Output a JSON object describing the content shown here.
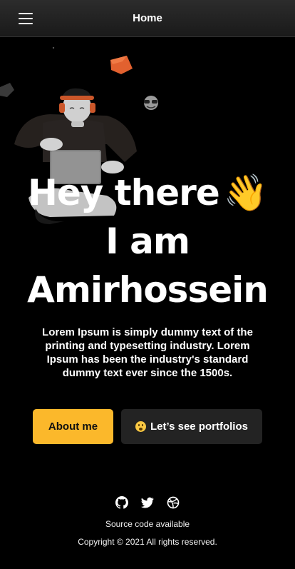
{
  "header": {
    "title": "Home",
    "menu_icon": "hamburger-menu-icon"
  },
  "hero": {
    "headline_line1": "Hey there",
    "headline_line2": "I am",
    "headline_line3": "Amirhossein",
    "wave_emoji": "👋",
    "description": "Lorem Ipsum is simply dummy text of the printing and typesetting industry. Lorem Ipsum has been the industry's standard dummy text ever since the 1500s."
  },
  "actions": {
    "about_label": "About me",
    "portfolio_label": "Let’s see portfolios",
    "about_color": "#fbb82b",
    "portfolio_bg": "#232323"
  },
  "footer": {
    "social_icons": [
      "github-icon",
      "twitter-icon",
      "dribbble-icon"
    ],
    "source_text": "Source code available",
    "copyright": "Copyright © 2021 All rights reserved."
  }
}
